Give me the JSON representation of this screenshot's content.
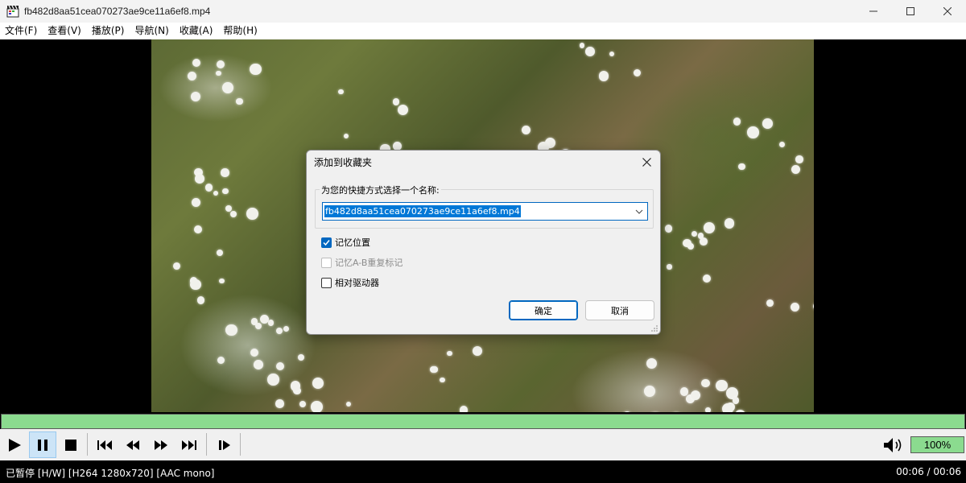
{
  "window": {
    "title": "fb482d8aa51cea070273ae9ce11a6ef8.mp4",
    "icon": "clapperboard-icon"
  },
  "menu": {
    "items": [
      {
        "label": "文件(F)"
      },
      {
        "label": "查看(V)"
      },
      {
        "label": "播放(P)"
      },
      {
        "label": "导航(N)"
      },
      {
        "label": "收藏(A)"
      },
      {
        "label": "帮助(H)"
      }
    ]
  },
  "dialog": {
    "title": "添加到收藏夹",
    "group_label": "为您的快捷方式选择一个名称:",
    "name_value": "fb482d8aa51cea070273ae9ce11a6ef8.mp4",
    "checkboxes": [
      {
        "label": "记忆位置",
        "checked": true,
        "enabled": true
      },
      {
        "label": "记忆A-B重复标记",
        "checked": false,
        "enabled": false
      },
      {
        "label": "相对驱动器",
        "checked": false,
        "enabled": true
      }
    ],
    "ok_label": "确定",
    "cancel_label": "取消"
  },
  "player": {
    "progress_fraction": 1.0,
    "volume": "100%",
    "state": "paused",
    "colors": {
      "seek": "#8bdb8f",
      "accent": "#0067c0"
    }
  },
  "status": {
    "left": "已暂停 [H/W] [H264 1280x720] [AAC mono]",
    "right": "00:06 / 00:06"
  }
}
